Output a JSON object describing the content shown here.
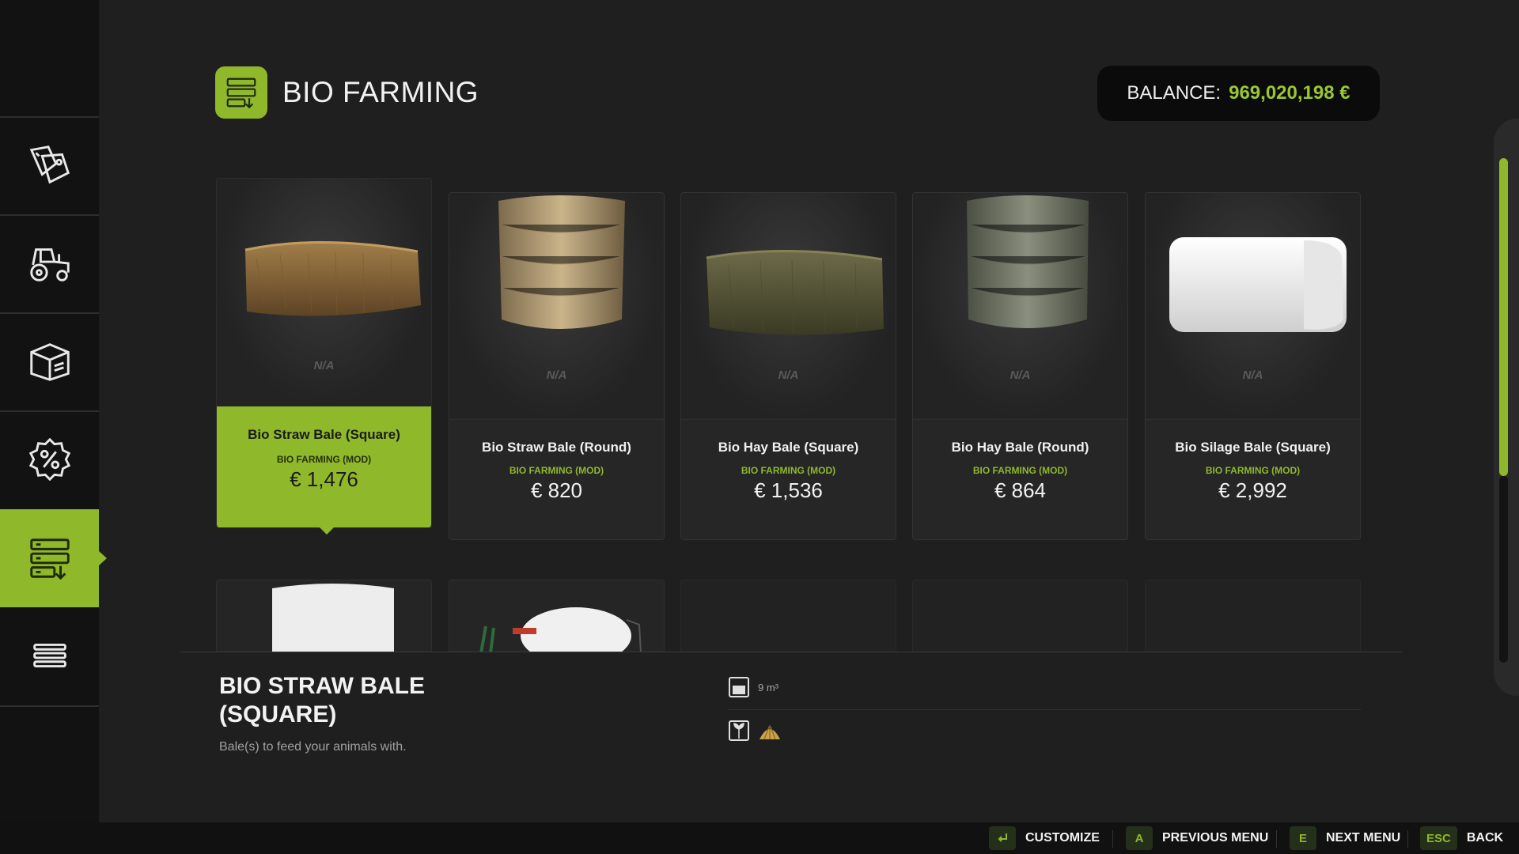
{
  "header": {
    "title": "BIO FARMING",
    "balance_label": "BALANCE:",
    "balance_value": "969,020,198 €"
  },
  "sidebar": {
    "items": [
      {
        "icon": "price-tags-icon"
      },
      {
        "icon": "tractor-icon"
      },
      {
        "icon": "box-icon"
      },
      {
        "icon": "percent-badge-icon"
      },
      {
        "icon": "bio-farming-icon",
        "active": true
      },
      {
        "icon": "list-menu-icon"
      }
    ]
  },
  "cards": [
    {
      "name": "Bio Straw Bale (Square)",
      "category": "BIO FARMING (MOD)",
      "price": "€ 1,476",
      "availability": "N/A",
      "selected": true
    },
    {
      "name": "Bio Straw Bale (Round)",
      "category": "BIO FARMING (MOD)",
      "price": "€ 820",
      "availability": "N/A"
    },
    {
      "name": "Bio Hay Bale (Square)",
      "category": "BIO FARMING (MOD)",
      "price": "€ 1,536",
      "availability": "N/A"
    },
    {
      "name": "Bio Hay Bale (Round)",
      "category": "BIO FARMING (MOD)",
      "price": "€ 864",
      "availability": "N/A"
    },
    {
      "name": "Bio Silage Bale (Square)",
      "category": "BIO FARMING (MOD)",
      "price": "€ 2,992",
      "availability": "N/A"
    }
  ],
  "detail": {
    "title": "BIO STRAW BALE (SQUARE)",
    "description": "Bale(s) to feed your animals with.",
    "capacity": "9 m³"
  },
  "footer": {
    "customize_label": "CUSTOMIZE",
    "prev_key": "A",
    "prev_label": "PREVIOUS MENU",
    "next_key": "E",
    "next_label": "NEXT MENU",
    "back_key": "ESC",
    "back_label": "BACK"
  },
  "colors": {
    "accent": "#8fb82b",
    "background": "#1f1f1f",
    "sidebar": "#121212"
  }
}
